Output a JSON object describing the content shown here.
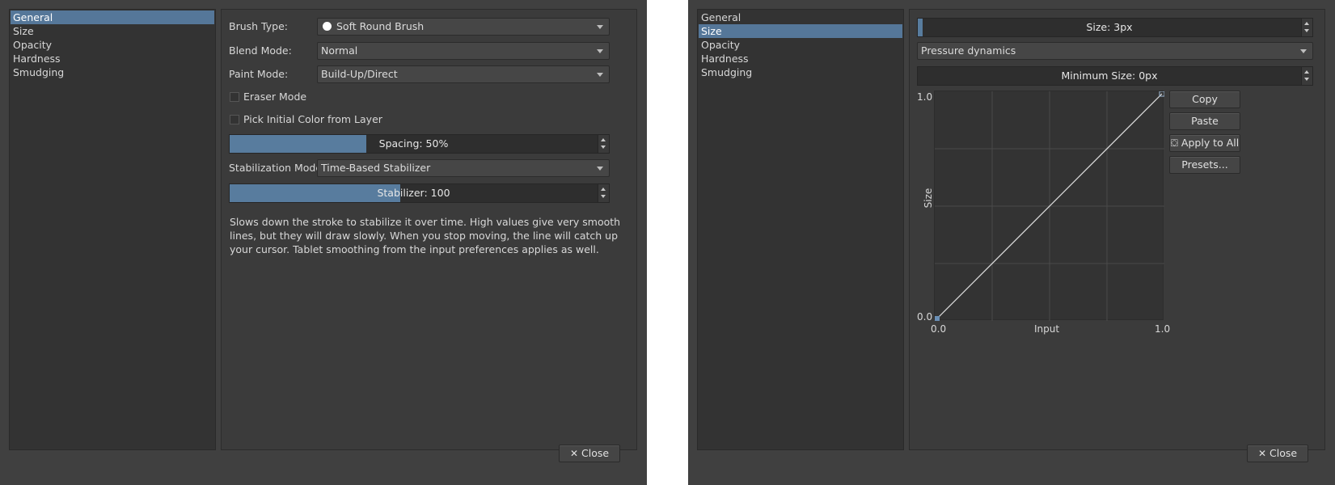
{
  "left_dialog": {
    "sidebar": {
      "items": [
        "General",
        "Size",
        "Opacity",
        "Hardness",
        "Smudging"
      ],
      "selected": "General"
    },
    "brush_type": {
      "label": "Brush Type:",
      "value": "Soft Round Brush"
    },
    "blend_mode": {
      "label": "Blend Mode:",
      "value": "Normal"
    },
    "paint_mode": {
      "label": "Paint Mode:",
      "value": "Build-Up/Direct"
    },
    "eraser_mode": {
      "label": "Eraser Mode",
      "checked": false
    },
    "pick_initial_color": {
      "label": "Pick Initial Color from Layer",
      "checked": false
    },
    "spacing": {
      "text": "Spacing: 50%",
      "fraction": 0.36
    },
    "stabilization_mode": {
      "label": "Stabilization Mode:",
      "value": "Time-Based Stabilizer"
    },
    "stabilizer": {
      "text": "Stabilizer: 100",
      "fraction": 0.45
    },
    "description": "Slows down the stroke to stabilize it over time. High values give very smooth lines, but they will draw slowly. When you stop moving, the line will catch up your cursor. Tablet smoothing from the input preferences applies as well.",
    "close_button": "Close"
  },
  "right_dialog": {
    "sidebar": {
      "items": [
        "General",
        "Size",
        "Opacity",
        "Hardness",
        "Smudging"
      ],
      "selected": "Size"
    },
    "size": {
      "text": "Size: 3px",
      "fraction": 0.01
    },
    "dynamics": {
      "value": "Pressure dynamics"
    },
    "minimum_size": {
      "text": "Minimum Size: 0px",
      "fraction": 0.0
    },
    "curve": {
      "y_label": "Size",
      "x_label": "Input",
      "y_max": "1.0",
      "y_min": "0.0",
      "x_min": "0.0",
      "x_max": "1.0"
    },
    "buttons": {
      "copy": "Copy",
      "paste": "Paste",
      "apply_to_all": "Apply to All",
      "presets": "Presets..."
    },
    "close_button": "Close"
  },
  "colors": {
    "panel": "#404040",
    "accent": "#557799",
    "fill": "#587c9e"
  },
  "icons": {
    "close": "close-icon",
    "apply": "paint-bucket-icon",
    "brush_dot": "round-brush-icon"
  }
}
